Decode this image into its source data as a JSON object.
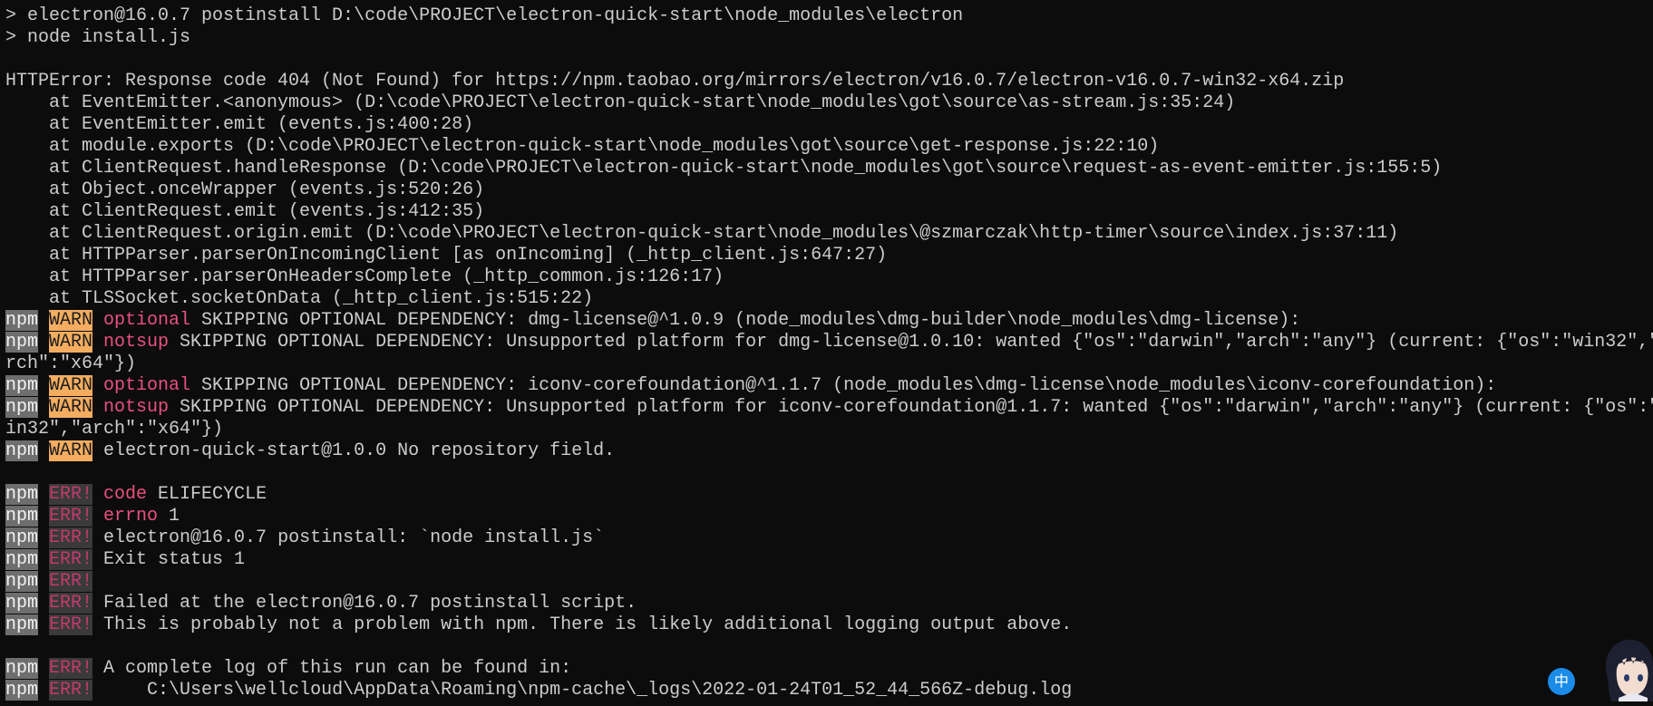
{
  "prompt": [
    "> electron@16.0.7 postinstall D:\\code\\PROJECT\\electron-quick-start\\node_modules\\electron",
    "> node install.js"
  ],
  "http_error": {
    "message": "HTTPError: Response code 404 (Not Found) for https://npm.taobao.org/mirrors/electron/v16.0.7/electron-v16.0.7-win32-x64.zip",
    "stack": [
      "    at EventEmitter.<anonymous> (D:\\code\\PROJECT\\electron-quick-start\\node_modules\\got\\source\\as-stream.js:35:24)",
      "    at EventEmitter.emit (events.js:400:28)",
      "    at module.exports (D:\\code\\PROJECT\\electron-quick-start\\node_modules\\got\\source\\get-response.js:22:10)",
      "    at ClientRequest.handleResponse (D:\\code\\PROJECT\\electron-quick-start\\node_modules\\got\\source\\request-as-event-emitter.js:155:5)",
      "    at Object.onceWrapper (events.js:520:26)",
      "    at ClientRequest.emit (events.js:412:35)",
      "    at ClientRequest.origin.emit (D:\\code\\PROJECT\\electron-quick-start\\node_modules\\@szmarczak\\http-timer\\source\\index.js:37:11)",
      "    at HTTPParser.parserOnIncomingClient [as onIncoming] (_http_client.js:647:27)",
      "    at HTTPParser.parserOnHeadersComplete (_http_common.js:126:17)",
      "    at TLSSocket.socketOnData (_http_client.js:515:22)"
    ]
  },
  "npm_prefix": "npm",
  "warn_label": "WARN",
  "err_label": "ERR!",
  "warnings": [
    {
      "tag": "optional",
      "text": "SKIPPING OPTIONAL DEPENDENCY: dmg-license@^1.0.9 (node_modules\\dmg-builder\\node_modules\\dmg-license):"
    },
    {
      "tag": "notsup",
      "text": "SKIPPING OPTIONAL DEPENDENCY: Unsupported platform for dmg-license@1.0.10: wanted {\"os\":\"darwin\",\"arch\":\"any\"} (current: {\"os\":\"win32\",\"",
      "wrap": "rch\":\"x64\"})"
    },
    {
      "tag": "optional",
      "text": "SKIPPING OPTIONAL DEPENDENCY: iconv-corefoundation@^1.1.7 (node_modules\\dmg-license\\node_modules\\iconv-corefoundation):"
    },
    {
      "tag": "notsup",
      "text": "SKIPPING OPTIONAL DEPENDENCY: Unsupported platform for iconv-corefoundation@1.1.7: wanted {\"os\":\"darwin\",\"arch\":\"any\"} (current: {\"os\":\"",
      "wrap": "in32\",\"arch\":\"x64\"})"
    },
    {
      "tag": "",
      "text": "electron-quick-start@1.0.0 No repository field."
    }
  ],
  "errors": [
    {
      "tag": "code",
      "text": "ELIFECYCLE"
    },
    {
      "tag": "errno",
      "text": "1"
    },
    {
      "tag": "",
      "text": "electron@16.0.7 postinstall: `node install.js`"
    },
    {
      "tag": "",
      "text": "Exit status 1"
    },
    {
      "tag": "",
      "text": ""
    },
    {
      "tag": "",
      "text": "Failed at the electron@16.0.7 postinstall script."
    },
    {
      "tag": "",
      "text": "This is probably not a problem with npm. There is likely additional logging output above."
    }
  ],
  "log": [
    {
      "text": "A complete log of this run can be found in:"
    },
    {
      "text": "    C:\\Users\\wellcloud\\AppData\\Roaming\\npm-cache\\_logs\\2022-01-24T01_52_44_566Z-debug.log"
    }
  ],
  "ime": {
    "label": "中"
  },
  "colors": {
    "background": "#0c0c0c",
    "text": "#cccccc",
    "npm_badge": "#6e6e6e",
    "warn_badge": "#f4ad60",
    "err_badge": "#3a3a3a",
    "err_text": "#c23a6c",
    "tag": "#e8517f",
    "ime": "#1a8ce8"
  },
  "icons": {
    "ime": "ime-chinese-icon",
    "avatar": "avatar-icon"
  }
}
